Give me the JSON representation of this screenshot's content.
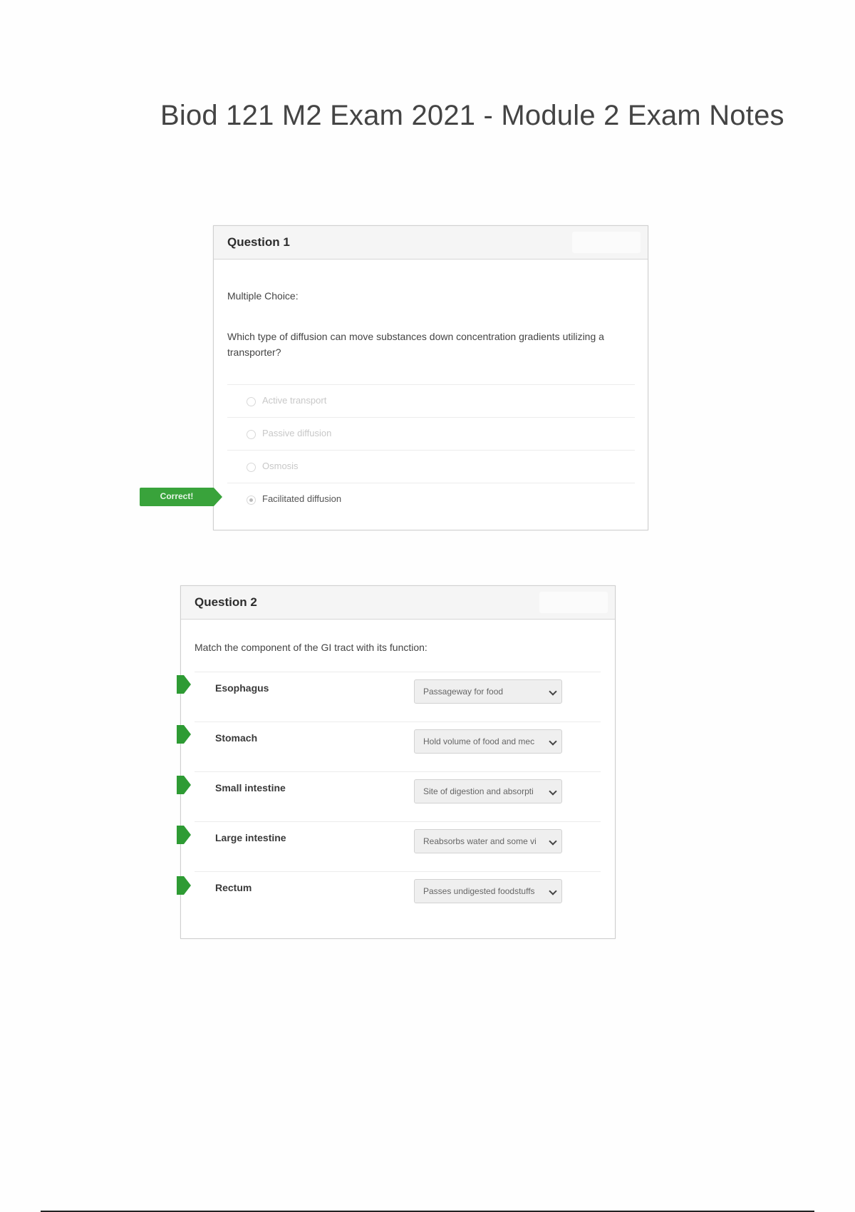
{
  "document": {
    "title": "Biod 121 M2 Exam 2021 - Module 2 Exam Notes"
  },
  "question1": {
    "title": "Question 1",
    "type_label": "Multiple Choice:",
    "prompt": "Which type of diffusion can move substances down concentration gradients utilizing a transporter?",
    "options": [
      {
        "label": "Active transport",
        "selected": false
      },
      {
        "label": "Passive diffusion",
        "selected": false
      },
      {
        "label": "Osmosis",
        "selected": false
      },
      {
        "label": "Facilitated diffusion",
        "selected": true
      }
    ],
    "feedback_label": "Correct!"
  },
  "question2": {
    "title": "Question 2",
    "prompt": "Match the component of the GI tract with its function:",
    "rows": [
      {
        "term": "Esophagus",
        "answer": "Passageway for food"
      },
      {
        "term": "Stomach",
        "answer": "Hold volume of food and mec"
      },
      {
        "term": "Small intestine",
        "answer": "Site of digestion and absorpti"
      },
      {
        "term": "Large intestine",
        "answer": "Reabsorbs water and some vi"
      },
      {
        "term": "Rectum",
        "answer": "Passes undigested foodstuffs"
      }
    ]
  },
  "colors": {
    "correct_green": "#39a33b",
    "marker_green": "#2e9b34"
  }
}
